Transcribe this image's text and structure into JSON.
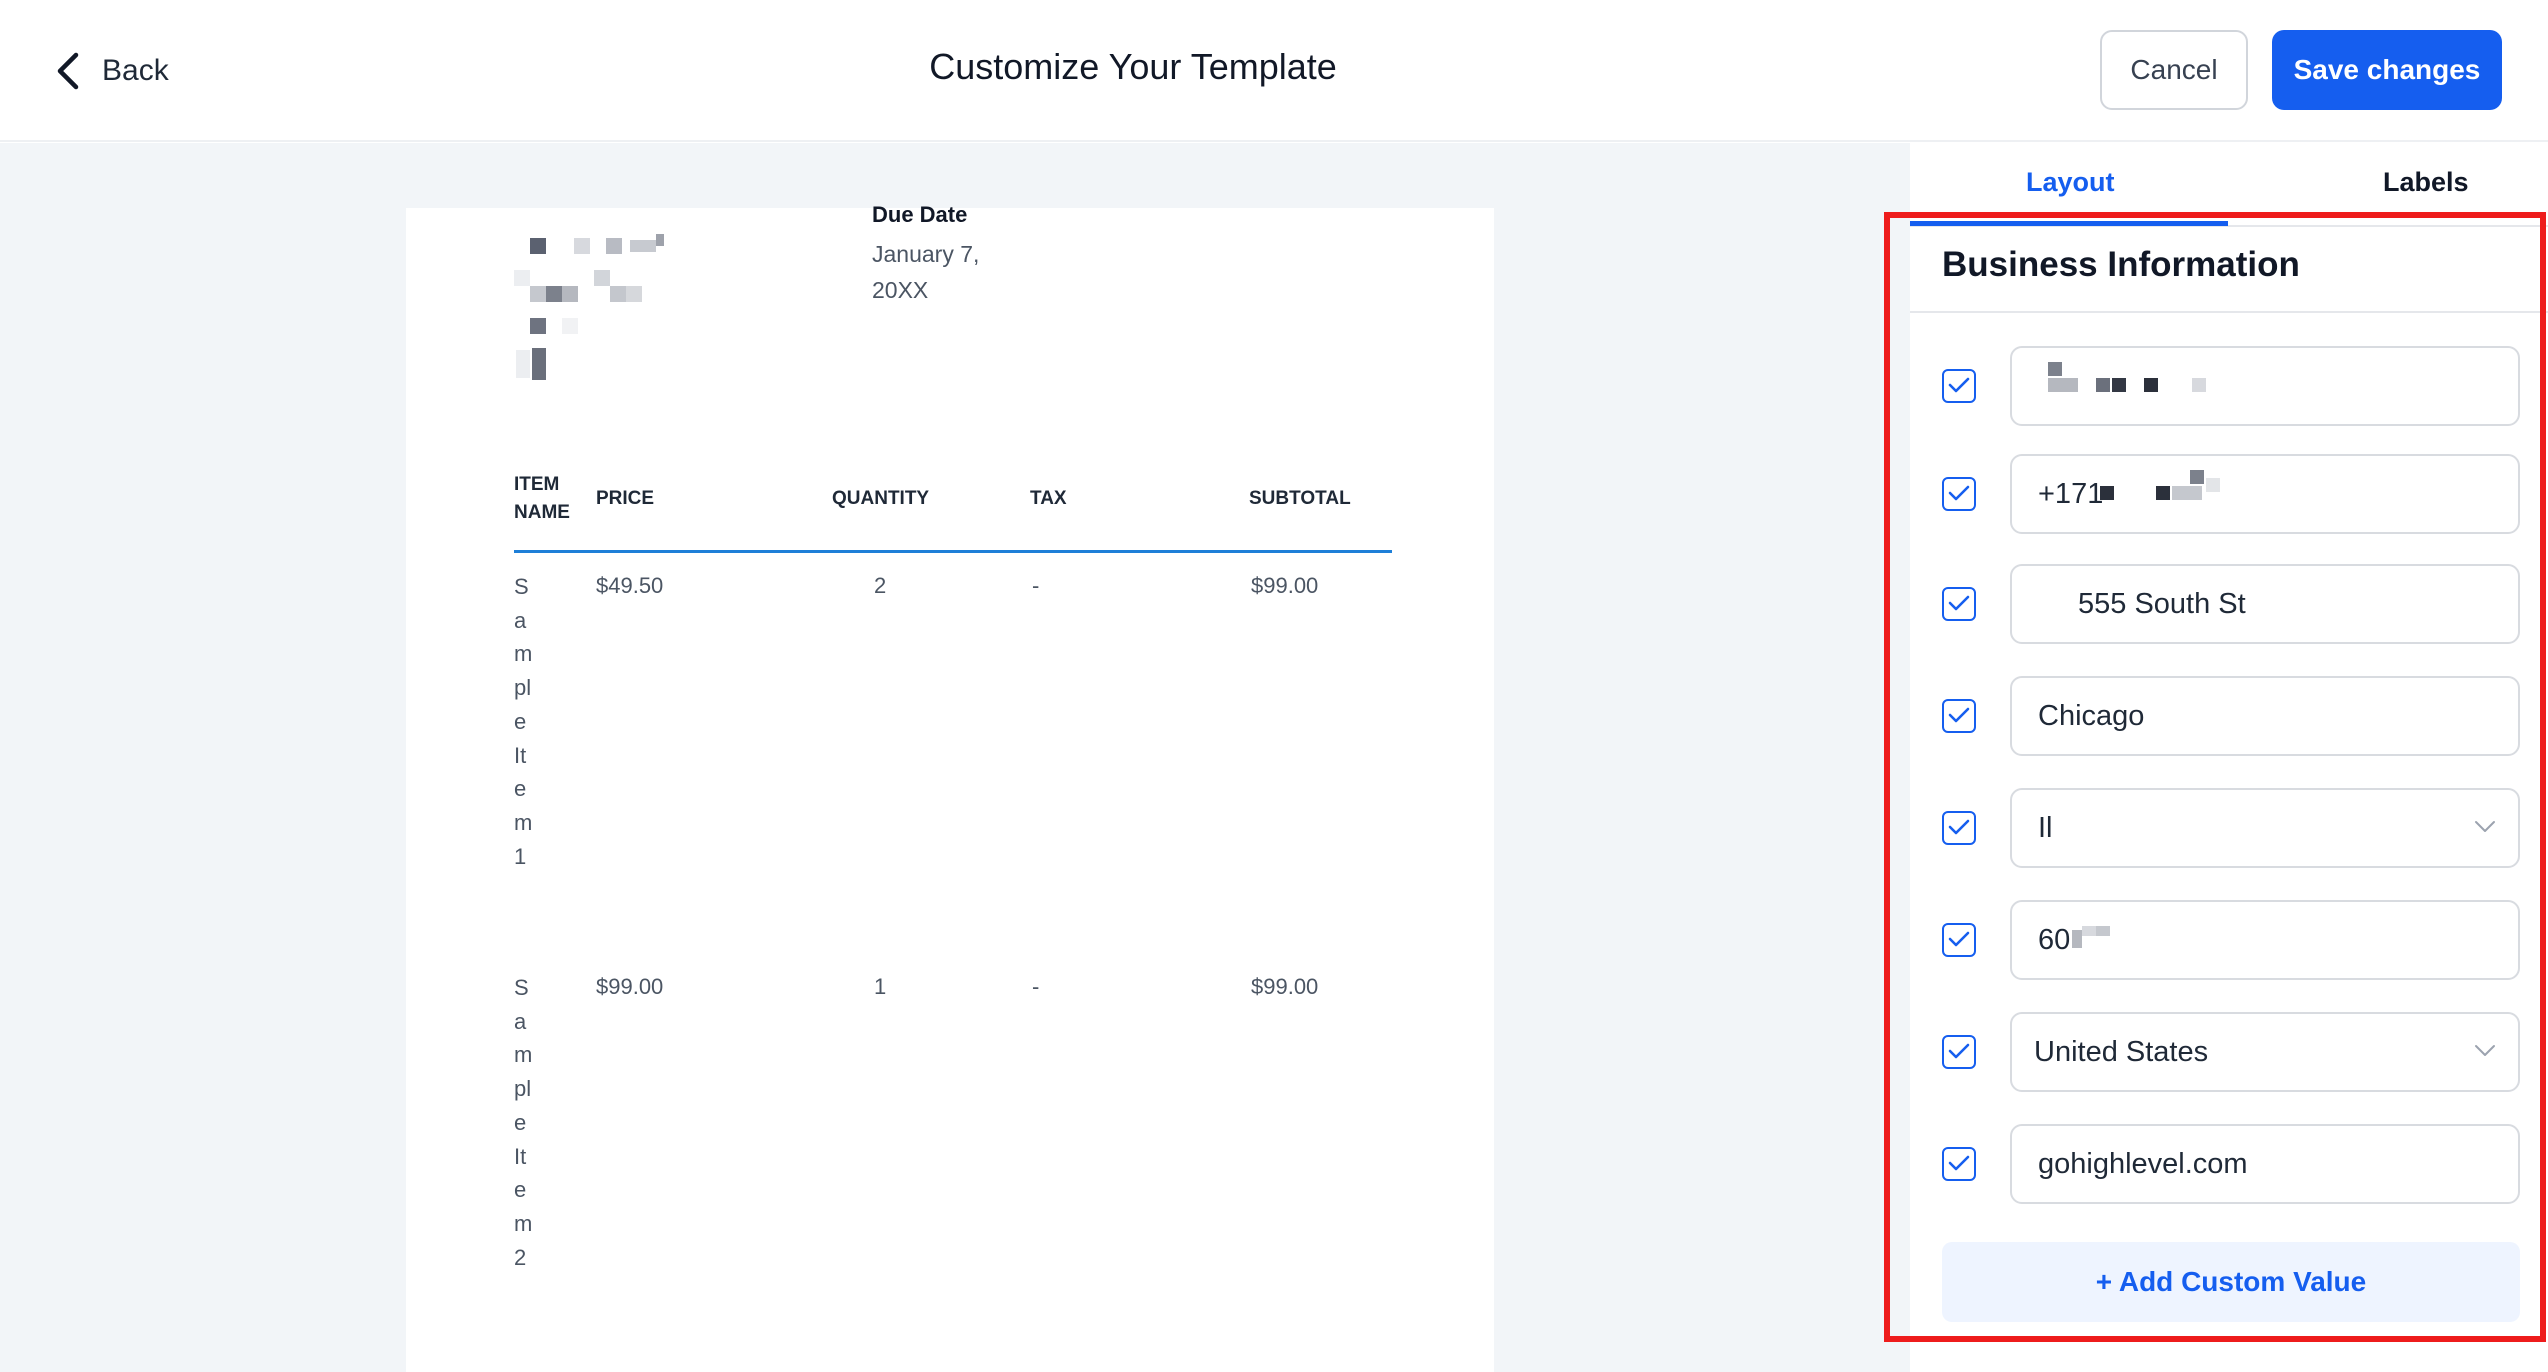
{
  "header": {
    "back_label": "Back",
    "title": "Customize Your Template",
    "cancel_label": "Cancel",
    "save_label": "Save changes"
  },
  "invoice": {
    "due_date_label": "Due Date",
    "due_date_value": "January 7, 20XX",
    "columns": {
      "item_name": "ITEM NAME",
      "price": "PRICE",
      "quantity": "QUANTITY",
      "tax": "TAX",
      "subtotal": "SUBTOTAL"
    },
    "rows": [
      {
        "name": "Sample Item 1",
        "price": "$49.50",
        "quantity": "2",
        "tax": "-",
        "subtotal": "$99.00"
      },
      {
        "name": "Sample Item 2",
        "price": "$99.00",
        "quantity": "1",
        "tax": "-",
        "subtotal": "$99.00"
      }
    ]
  },
  "panel": {
    "tabs": [
      {
        "label": "Layout",
        "active": true
      },
      {
        "label": "Labels",
        "active": false
      }
    ],
    "section_title": "Business Information",
    "fields": [
      {
        "value": "",
        "checked": true,
        "type": "text"
      },
      {
        "value": "+171",
        "checked": true,
        "type": "text"
      },
      {
        "value": "555 South St",
        "checked": true,
        "type": "text"
      },
      {
        "value": "Chicago",
        "checked": true,
        "type": "text"
      },
      {
        "value": "Il",
        "checked": true,
        "type": "select"
      },
      {
        "value": "60",
        "checked": true,
        "type": "text"
      },
      {
        "value": "United States",
        "checked": true,
        "type": "select"
      },
      {
        "value": "gohighlevel.com",
        "checked": true,
        "type": "text"
      }
    ],
    "add_custom_label": "+ Add Custom Value"
  },
  "colors": {
    "accent": "#155eef",
    "highlight_box": "#ee1c1c",
    "table_rule": "#1e7fd8",
    "preview_bg": "#f2f5f8"
  },
  "icons": [
    "chevron-left-icon",
    "checkbox-checked-icon",
    "chevron-down-icon"
  ]
}
